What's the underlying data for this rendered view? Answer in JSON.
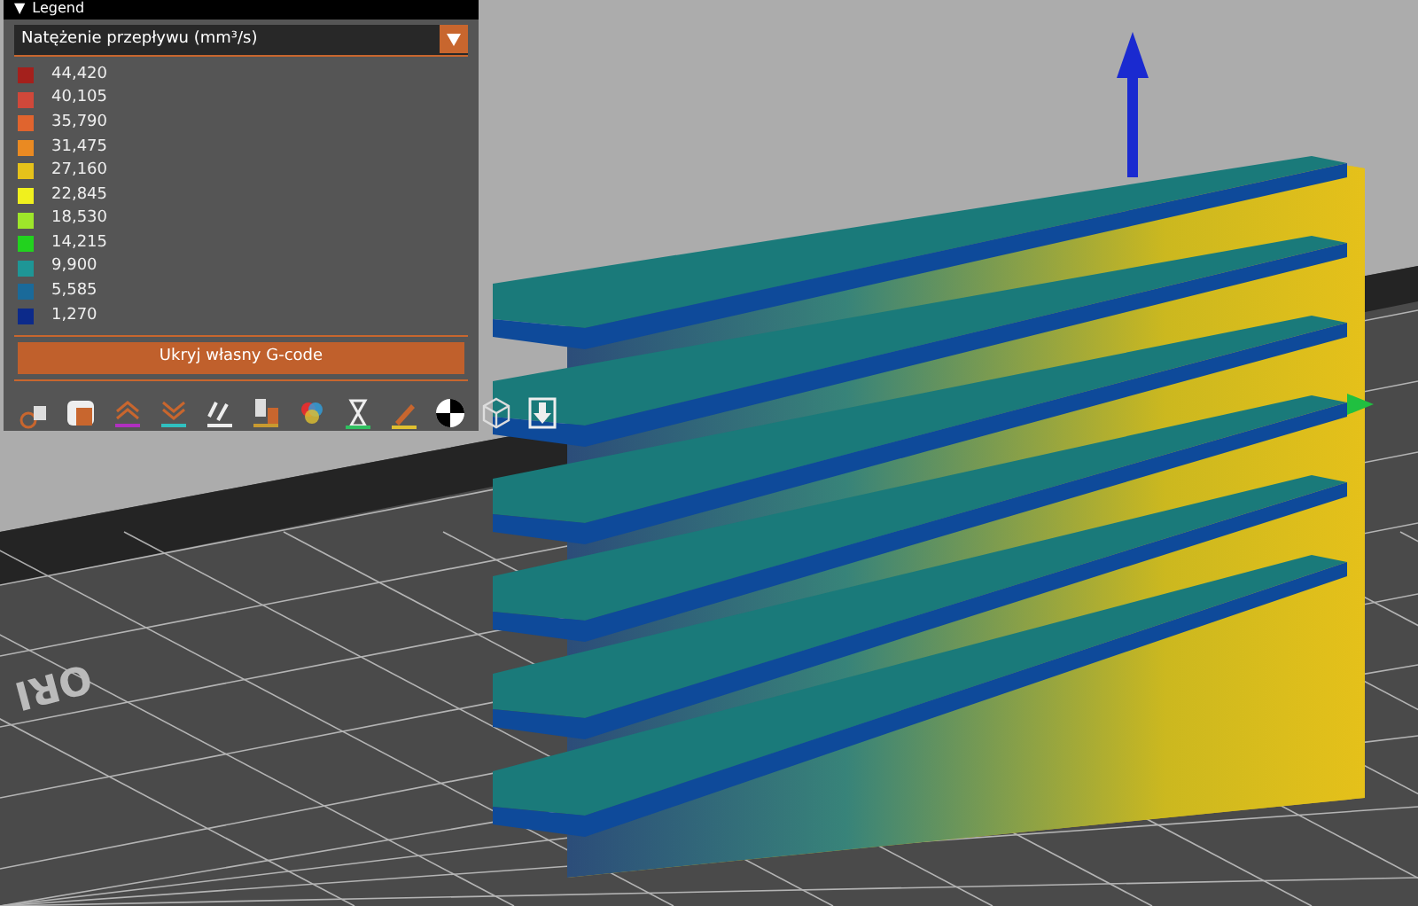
{
  "legend": {
    "title": "Legend",
    "collapse_glyph": "▼",
    "view_type": "Natężenie przepływu (mm³/s)",
    "items": [
      {
        "label": "44,420",
        "color": "#a4201c"
      },
      {
        "label": "40,105",
        "color": "#d0483a"
      },
      {
        "label": "35,790",
        "color": "#e0642e"
      },
      {
        "label": "31,475",
        "color": "#ea8a22"
      },
      {
        "label": "27,160",
        "color": "#e6c21a"
      },
      {
        "label": "22,845",
        "color": "#f0f01e"
      },
      {
        "label": "18,530",
        "color": "#9ee62a"
      },
      {
        "label": "14,215",
        "color": "#22d21e"
      },
      {
        "label": "9,900",
        "color": "#1e9696"
      },
      {
        "label": "5,585",
        "color": "#1a6a9a"
      },
      {
        "label": "1,270",
        "color": "#0c2a8a"
      }
    ],
    "button": "Ukryj własny G-code"
  },
  "bed_label": "ORI"
}
